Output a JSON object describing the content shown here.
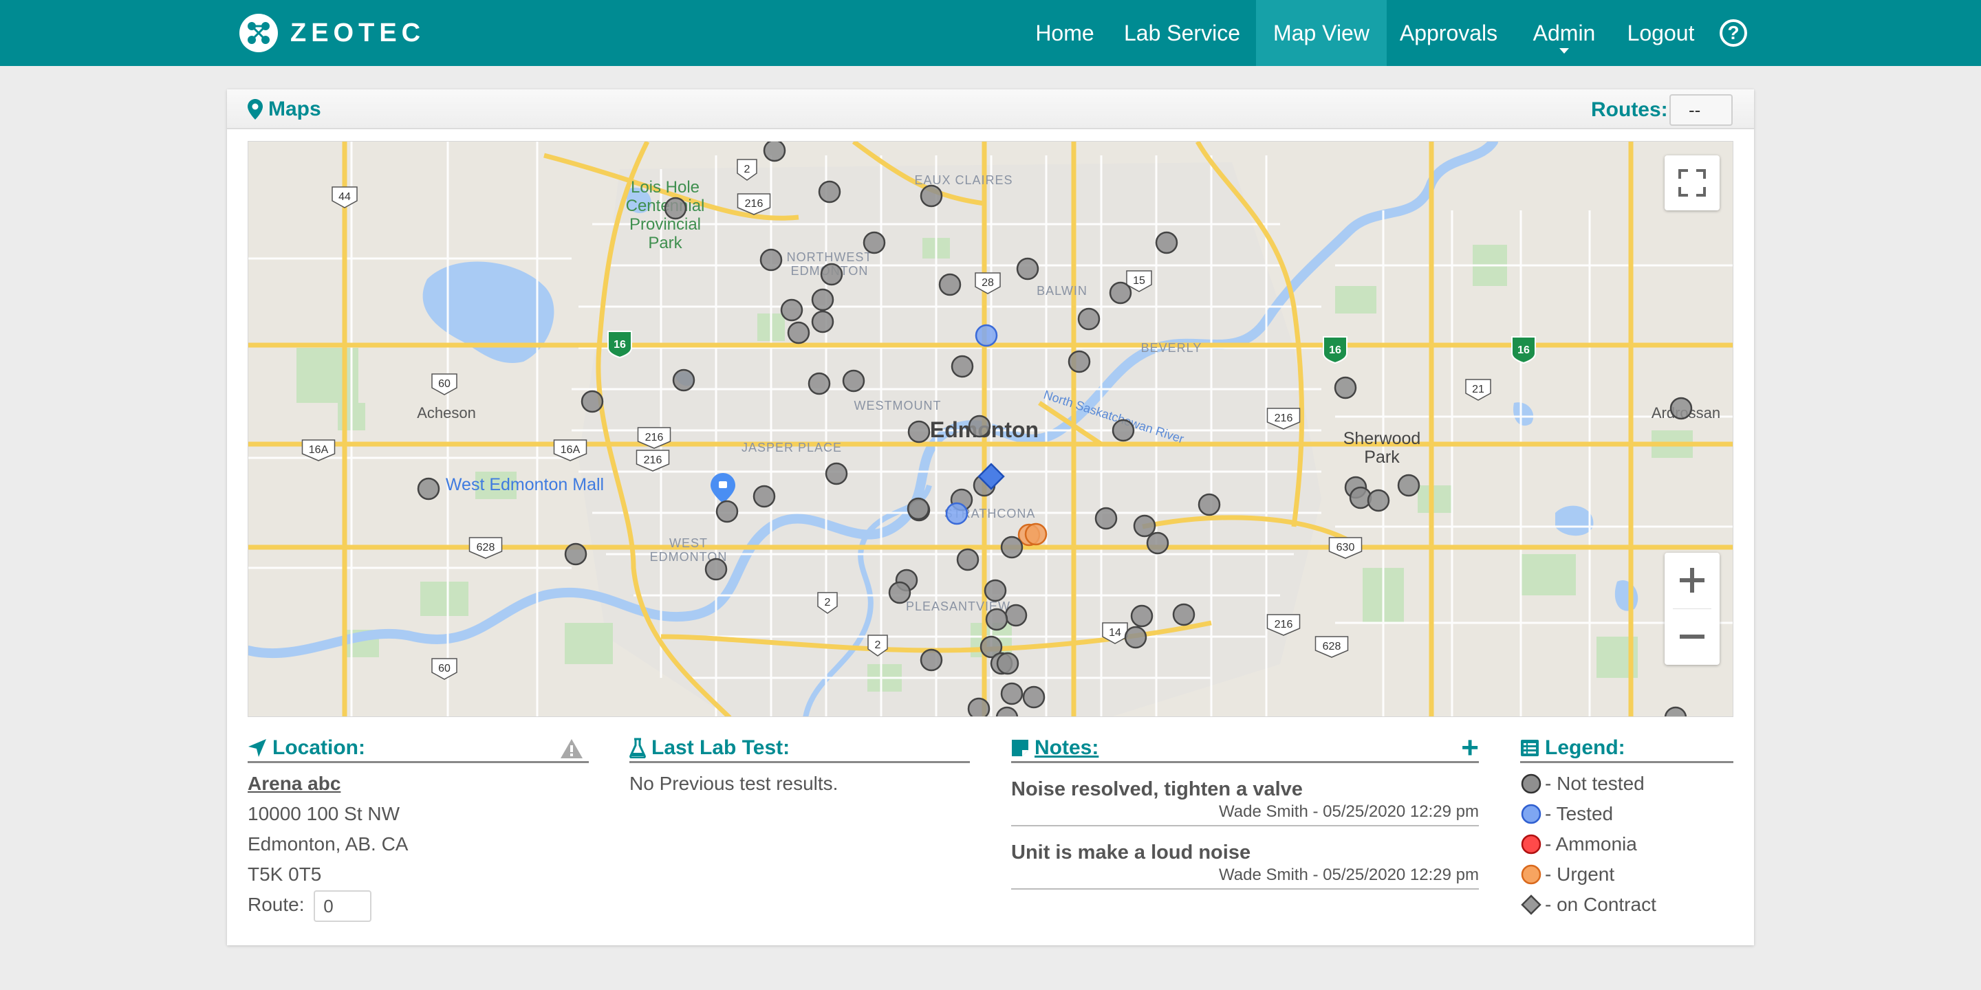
{
  "app": {
    "brand": "ZEOTEC"
  },
  "nav": {
    "home": "Home",
    "lab_service": "Lab Service",
    "map_view": "Map View",
    "approvals": "Approvals",
    "admin": "Admin",
    "logout": "Logout",
    "help": "?"
  },
  "panel": {
    "title": "Maps",
    "routes_label": "Routes:",
    "routes_value": "--"
  },
  "map": {
    "labels": {
      "edmonton": "Edmonton",
      "sherwood_park": "Sherwood Park",
      "sherwood": "Sherwood",
      "park": "Park",
      "acheson": "Acheson",
      "ardrossan": "Ardrossan",
      "west_edmonton_mall": "West Edmonton Mall",
      "lois_hole_1": "Lois Hole",
      "lois_hole_2": "Centennial",
      "lois_hole_3": "Provincial",
      "lois_hole_4": "Park",
      "eaux_claires": "EAUX CLAIRES",
      "northwest_1": "NORTHWEST",
      "northwest_2": "EDMONTON",
      "balwin": "BALWIN",
      "beverly": "BEVERLY",
      "westmount": "WESTMOUNT",
      "jasper_place": "JASPER PLACE",
      "strathcona": "STRATHCONA",
      "west_edm_1": "WEST",
      "west_edm_2": "EDMONTON",
      "pleasantview": "PLEASANTVIEW",
      "river": "North Saskatchewan River"
    },
    "shields": {
      "h44": "44",
      "h2a": "2",
      "h216a": "216",
      "h28": "28",
      "h15": "15",
      "h60a": "60",
      "h16a": "16A",
      "h16b": "16A",
      "h216b": "216",
      "h216c": "216",
      "h216d": "216",
      "h21": "21",
      "h628a": "628",
      "h630": "630",
      "h2b": "2",
      "h2c": "2",
      "h14": "14",
      "h216e": "216",
      "h628b": "628",
      "h60b": "60",
      "h16x": "16",
      "h16y": "16",
      "h16z": "16"
    },
    "marker_colors": {
      "not_tested": "#8f8f8f",
      "tested": "#7ea6f2",
      "urgent": "#f2a162",
      "contract": "#4a7ee6"
    }
  },
  "location": {
    "heading": "Location:",
    "name": "Arena abc",
    "street": "10000 100 St NW",
    "city": "Edmonton, AB. CA",
    "postal": "T5K 0T5",
    "route_label": "Route:",
    "route_value": "0"
  },
  "lab": {
    "heading": "Last Lab Test:",
    "empty_text": "No Previous test results."
  },
  "notes": {
    "heading": "Notes:",
    "items": [
      {
        "title": "Noise resolved, tighten a valve",
        "meta": "Wade Smith - 05/25/2020 12:29 pm"
      },
      {
        "title": "Unit is make a loud noise",
        "meta": "Wade Smith - 05/25/2020 12:29 pm"
      }
    ]
  },
  "legend": {
    "heading": "Legend:",
    "not_tested": "- Not tested",
    "tested": "- Tested",
    "ammonia": "- Ammonia",
    "urgent": "- Urgent",
    "on_contract": "- on Contract",
    "colors": {
      "not_tested": "#8f8f8f",
      "tested": "#7ea6f2",
      "ammonia": "#ff4a4a",
      "urgent": "#f7a460",
      "on_contract": "#9a9a9a"
    }
  }
}
